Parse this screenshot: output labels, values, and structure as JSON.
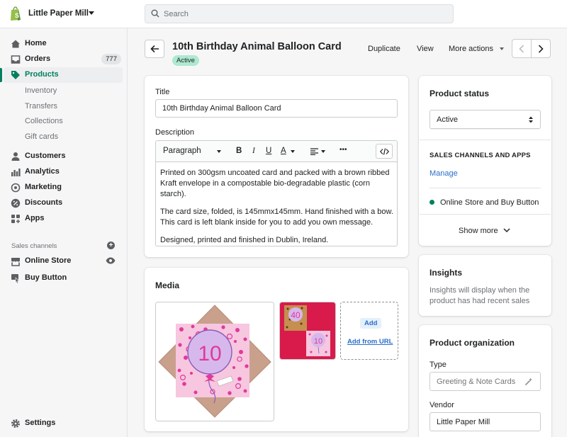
{
  "store": {
    "name": "Little Paper Mill"
  },
  "search": {
    "placeholder": "Search"
  },
  "sidebar": {
    "items": [
      {
        "label": "Home"
      },
      {
        "label": "Orders",
        "badge": "777"
      },
      {
        "label": "Products"
      },
      {
        "label": "Customers"
      },
      {
        "label": "Analytics"
      },
      {
        "label": "Marketing"
      },
      {
        "label": "Discounts"
      },
      {
        "label": "Apps"
      }
    ],
    "product_sub": [
      "Inventory",
      "Transfers",
      "Collections",
      "Gift cards"
    ],
    "channels_label": "Sales channels",
    "channels": [
      {
        "label": "Online Store"
      },
      {
        "label": "Buy Button"
      }
    ],
    "settings": "Settings"
  },
  "header": {
    "title": "10th Birthday Animal Balloon Card",
    "status": "Active",
    "actions": {
      "duplicate": "Duplicate",
      "view": "View",
      "more": "More actions"
    }
  },
  "product": {
    "title_label": "Title",
    "title_value": "10th Birthday Animal Balloon Card",
    "description_label": "Description",
    "toolbar": {
      "format": "Paragraph",
      "bold": "B",
      "italic": "I",
      "underline": "U",
      "color": "A",
      "more": "•••"
    },
    "description": [
      "Printed on 300gsm uncoated card and packed with a brown ribbed Kraft envelope in a compostable bio-degradable plastic (corn starch).",
      "The card size, folded, is 145mmx145mm. Hand finished with a bow. This card is left blank inside for you to add you own message.",
      "Designed, printed and finished in Dublin, Ireland."
    ]
  },
  "media": {
    "title": "Media",
    "add": "Add",
    "add_url": "Add from URL",
    "card_number": "10",
    "thumb_number_1": "40",
    "thumb_number_2": "10"
  },
  "status_card": {
    "title": "Product status",
    "value": "Active",
    "channels_title": "SALES CHANNELS AND APPS",
    "manage": "Manage",
    "channel": "Online Store and Buy Button",
    "show_more": "Show more"
  },
  "insights": {
    "title": "Insights",
    "text": "Insights will display when the product has had recent sales"
  },
  "organization": {
    "title": "Product organization",
    "type_label": "Type",
    "type_placeholder": "Greeting & Note Cards",
    "vendor_label": "Vendor",
    "vendor_value": "Little Paper Mill"
  },
  "colors": {
    "accent": "#008060",
    "link": "#2c6ecb",
    "status_bg": "#aee9d1"
  }
}
